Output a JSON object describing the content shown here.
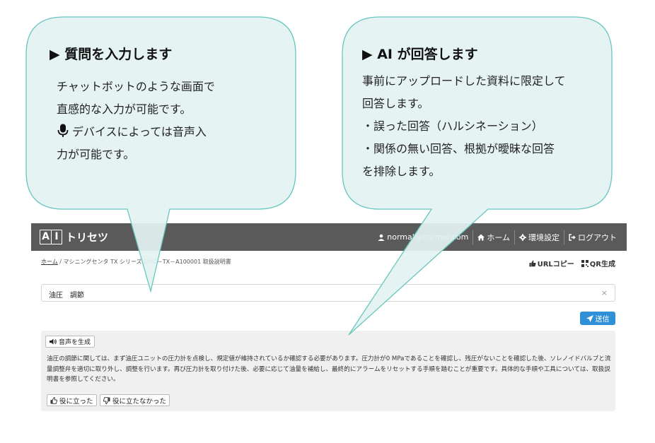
{
  "bubble_left": {
    "title": "▶ 質問を入力します",
    "lines": [
      "チャットボットのような画面で",
      "直感的な入力が可能です。",
      "デバイスによっては音声入",
      "力が可能です。"
    ]
  },
  "bubble_right": {
    "title": "▶ AI が回答します",
    "lines": [
      "事前にアップロードした資料に限定して",
      "回答します。",
      "・誤った回答（ハルシネーション）",
      "・関係の無い回答、根拠が曖昧な回答",
      "を排除します。"
    ]
  },
  "colors": {
    "bubble_fill": "#e3f3f2",
    "bubble_stroke": "#68c6bf",
    "navbar": "#5a5a5a",
    "accent": "#2f8fd7",
    "answer_bg": "#f0f0f0"
  },
  "navbar": {
    "logo_letters": [
      "A",
      "I"
    ],
    "logo_text": "トリセツ",
    "user": "normal@normal.com",
    "home": "ホーム",
    "settings": "環境設定",
    "logout": "ログアウト"
  },
  "breadcrumb": {
    "home": "ホーム",
    "sep": " / ",
    "rest": "マシニングセンタ  TX シリーズ  DMC－TX－A100001 取扱説明書"
  },
  "tools": {
    "url_copy": "URLコピー",
    "qr": "QR生成"
  },
  "query": {
    "value": "油圧　調節",
    "clear": "×"
  },
  "send_label": "送信",
  "answer": {
    "voice_label": "音声を生成",
    "text": "油圧の調節に関しては、まず油圧ユニットの圧力計を点検し、規定値が維持されているか確認する必要があります。圧力計が0 MPaであることを確認し、残圧がないことを確認した後、ソレノイドバルブと流量調整弁を適切に取り外し、調整を行います。再び圧力計を取り付けた後、必要に応じて油量を補給し、最終的にアラームをリセットする手順を踏むことが重要です。具体的な手順や工具については、取扱説明書を参照してください。",
    "helpful": "役に立った",
    "not_helpful": "役に立たなかった"
  },
  "icons": [
    "mic-icon",
    "user-icon",
    "home-icon",
    "gear-icon",
    "logout-icon",
    "thumb-icon",
    "qr-icon",
    "send-icon",
    "speaker-icon",
    "thumbs-up-icon",
    "thumbs-down-icon"
  ]
}
